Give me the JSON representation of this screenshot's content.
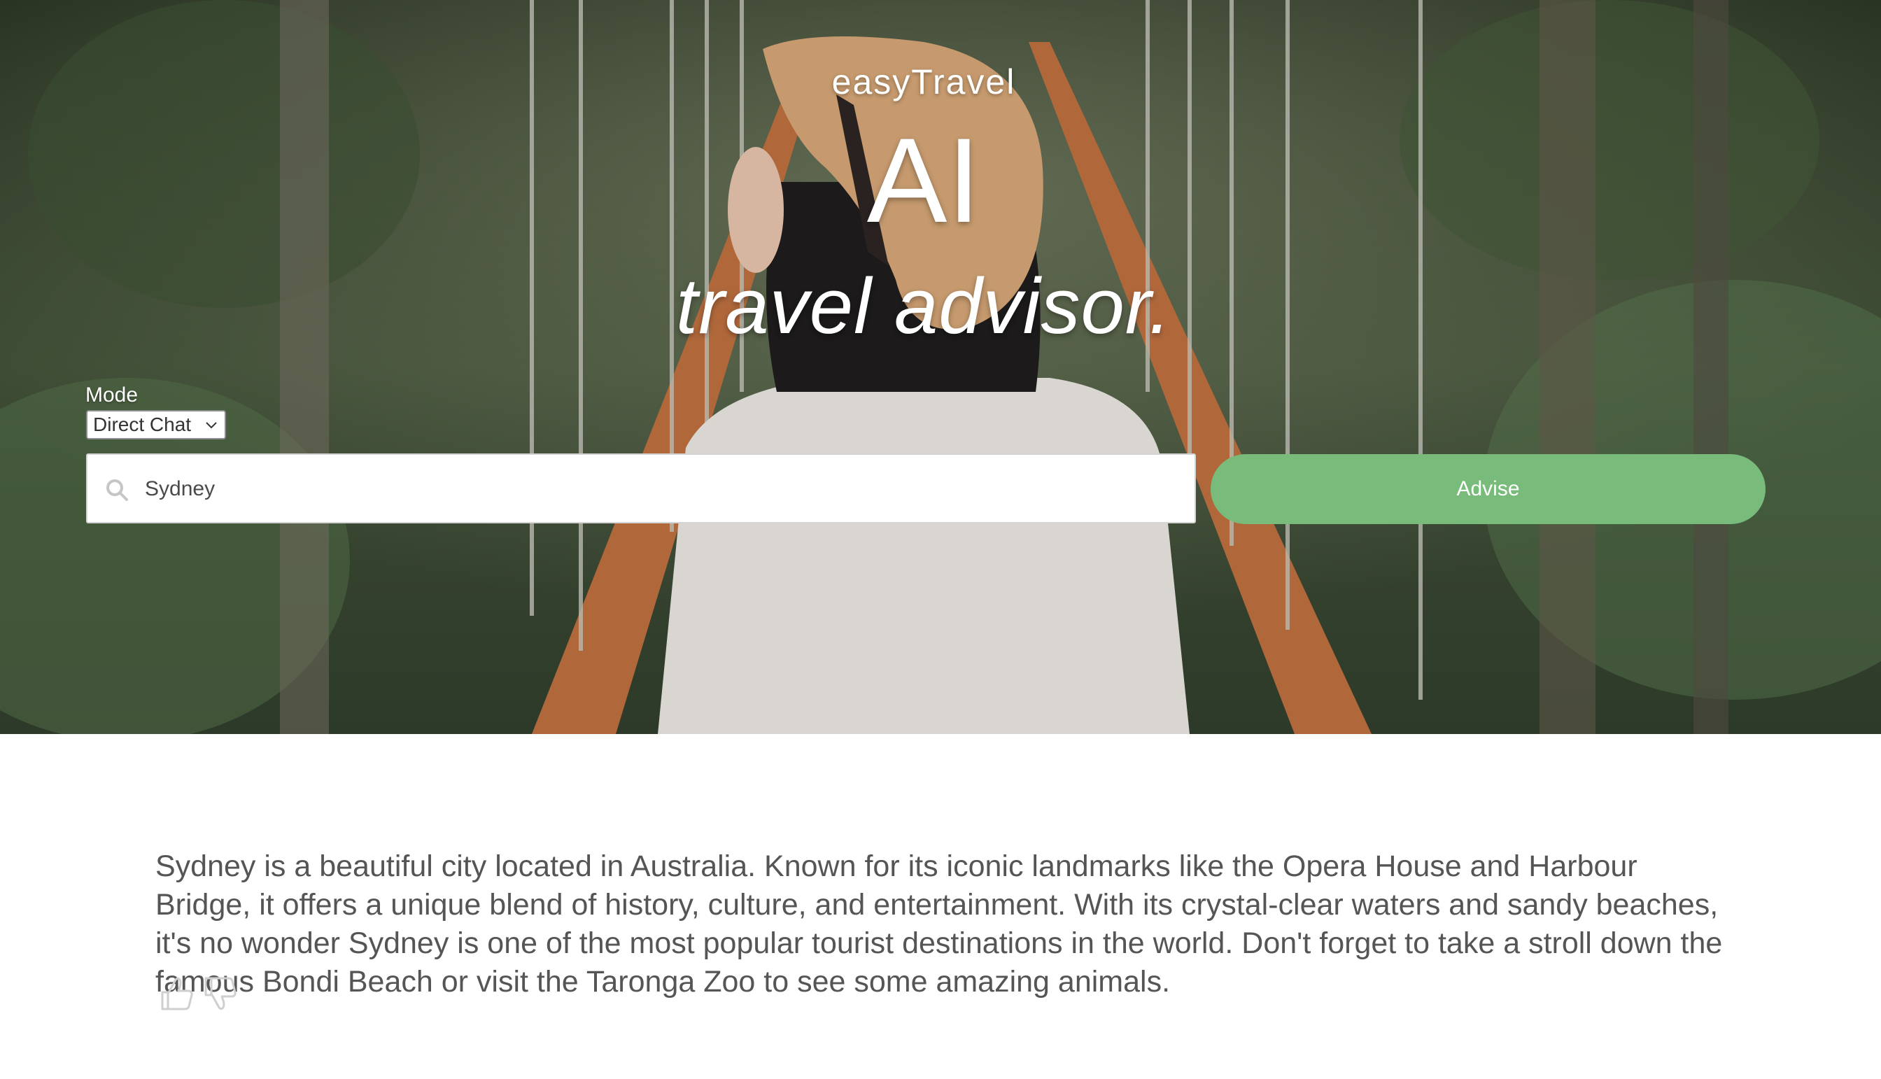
{
  "header": {
    "brand": "easyTravel",
    "title": "AI",
    "subtitle": "travel advisor."
  },
  "mode": {
    "label": "Mode",
    "selected": "Direct Chat"
  },
  "search": {
    "value": "Sydney",
    "icon": "search-icon"
  },
  "advise_button": {
    "label": "Advise"
  },
  "result": {
    "text": "Sydney is a beautiful city located in Australia. Known for its iconic landmarks like the Opera House and Harbour Bridge, it offers a unique blend of history, culture, and entertainment. With its crystal-clear waters and sandy beaches, it's no wonder Sydney is one of the most popular tourist destinations in the world. Don't forget to take a stroll down the famous Bondi Beach or visit the Taronga Zoo to see some amazing animals."
  },
  "feedback": {
    "like_icon": "thumbs-up-icon",
    "dislike_icon": "thumbs-down-icon"
  },
  "colors": {
    "accent": "#78bb7b",
    "text": "#555555",
    "icon_muted": "#cfcfcf"
  }
}
